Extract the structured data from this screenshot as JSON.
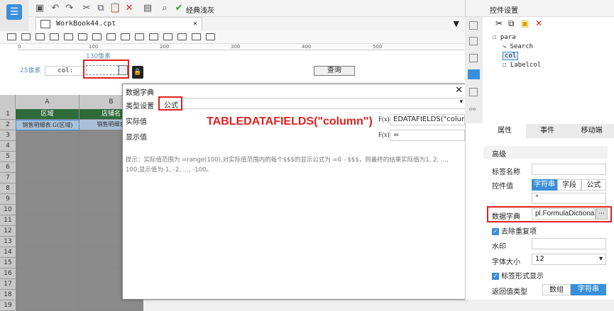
{
  "toolbar": {
    "style_label": "经典浅灰"
  },
  "tab": {
    "title": "WorkBook44.cpt"
  },
  "design": {
    "ruler_ticks": [
      "0",
      "100",
      "200",
      "300",
      "400",
      "500"
    ],
    "px_130": "130像素",
    "px_25": "25像素",
    "col_label": "col:",
    "query_button": "查询"
  },
  "sheet": {
    "col_headers": [
      "A",
      "B"
    ],
    "row1": [
      "区域",
      "店铺名"
    ],
    "row2": [
      "销售明细表.G(区域)",
      "销售明细表"
    ],
    "row_numbers": [
      "1",
      "2",
      "3",
      "4",
      "5",
      "6",
      "7",
      "8",
      "9",
      "10",
      "11",
      "12",
      "13",
      "14",
      "15",
      "16",
      "17",
      "18",
      "19"
    ]
  },
  "dialog": {
    "title": "数据字典",
    "type_label": "类型设置",
    "type_value": "公式",
    "actual_label": "实际值",
    "actual_formula": "EDATAFIELDS(\"column\")",
    "display_label": "显示值",
    "display_formula": "=",
    "fx": "F(x)",
    "annotation": "TABLEDATAFIELDS(\"column\")",
    "hint": "提示：实际值范围为 =range(100),对实际值范围内的每个$$$的显示公式为 =0 - $$$，则最终的结果实际值为1, 2, ..., 100,显示值为-1, -2, ..., -100。"
  },
  "panel": {
    "title": "控件设置",
    "tree": [
      "para",
      "Search",
      "col",
      "Labelcol"
    ],
    "tabs": [
      "属性",
      "事件",
      "移动端"
    ],
    "section": "高级",
    "label_name": "标签名称",
    "widget_value": "控件值",
    "value_types": [
      "字符串",
      "字段",
      "公式"
    ],
    "value_field": "\"",
    "dict_label": "数据字典",
    "dict_value": "pl.FormulaDictionary",
    "dict_more": "···",
    "remove_dup": "去除重复项",
    "watermark": "水印",
    "font_size_label": "字体大小",
    "font_size": "12",
    "label_display": "标签形式显示",
    "return_type_label": "返回值类型",
    "return_types": [
      "数组",
      "字符串"
    ]
  },
  "colors": {
    "accent": "#3a8fd9",
    "highlight": "#e02020",
    "header_green": "#2f6b3a"
  }
}
